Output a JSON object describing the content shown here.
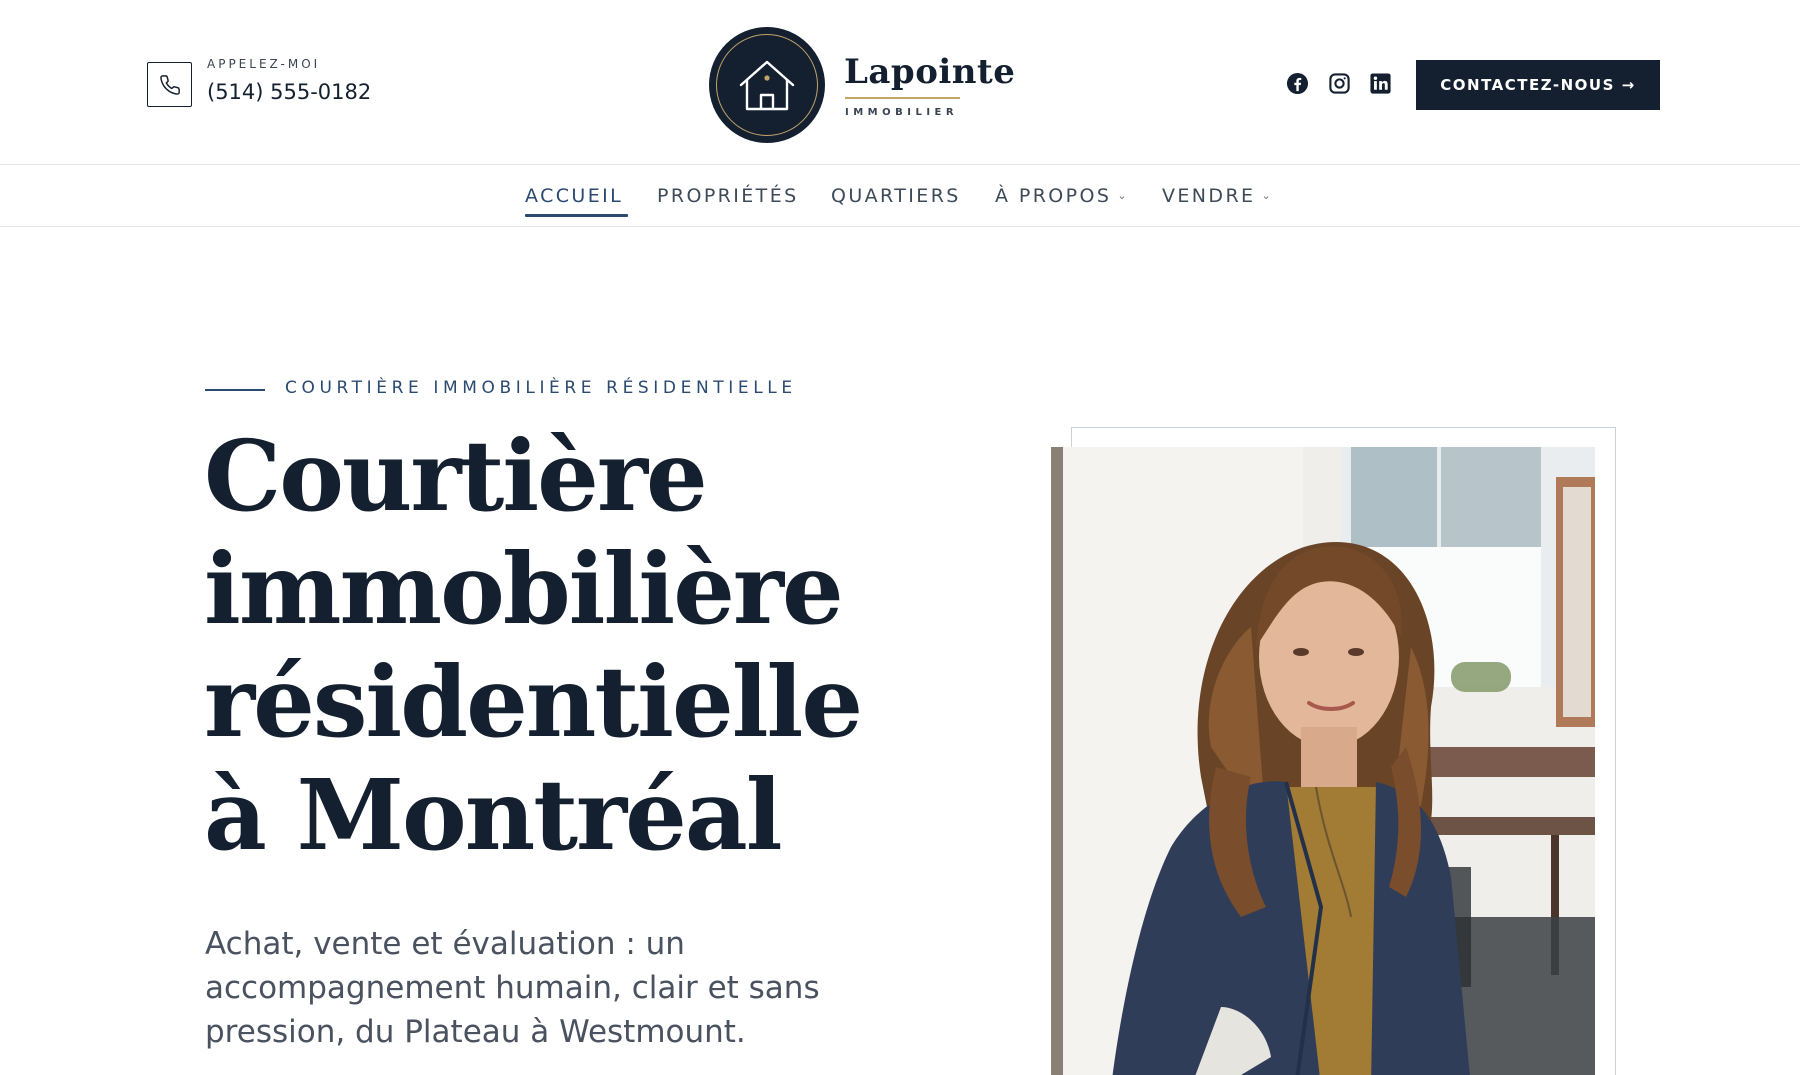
{
  "header": {
    "phone_label": "APPELEZ-MOI",
    "phone_number": "(514) 555-0182",
    "brand_name": "Lapointe",
    "brand_sub": "IMMOBILIER",
    "social": [
      "facebook-icon",
      "instagram-icon",
      "linkedin-icon"
    ],
    "cta_label": "CONTACTEZ-NOUS →"
  },
  "nav": {
    "items": [
      {
        "label": "ACCUEIL",
        "active": true,
        "dropdown": false
      },
      {
        "label": "PROPRIÉTÉS",
        "active": false,
        "dropdown": false
      },
      {
        "label": "QUARTIERS",
        "active": false,
        "dropdown": false
      },
      {
        "label": "À PROPOS",
        "active": false,
        "dropdown": true
      },
      {
        "label": "VENDRE",
        "active": false,
        "dropdown": true
      }
    ]
  },
  "hero": {
    "eyebrow": "COURTIÈRE IMMOBILIÈRE RÉSIDENTIELLE",
    "title_lines": [
      "Courtière",
      "immobilière",
      "résidentielle",
      "à Montréal"
    ],
    "subtitle": "Achat, vente et évaluation : un accompagnement humain, clair et sans pression, du Plateau à Westmount."
  },
  "colors": {
    "navy": "#14202f",
    "accent_blue": "#2b4a70",
    "gold": "#c0a46a",
    "border": "#e3e5e8"
  }
}
